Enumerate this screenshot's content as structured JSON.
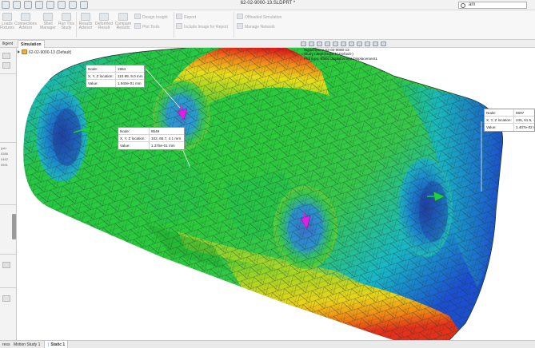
{
  "window": {
    "title": "62-02-9000-13.SLDPRT *",
    "search_value": "am"
  },
  "ribbon": {
    "buttons": [
      {
        "label_1": "Loads",
        "label_2": "Fixtures"
      },
      {
        "label_1": "Connections",
        "label_2": "Advisor"
      },
      {
        "label_1": "Shell",
        "label_2": "Manager"
      },
      {
        "label_1": "Run This",
        "label_2": "Study"
      },
      {
        "label_1": "Results",
        "label_2": "Advisor"
      },
      {
        "label_1": "Deformed",
        "label_2": "Result"
      },
      {
        "label_1": "Compare",
        "label_2": "Results"
      }
    ],
    "small_items": {
      "design_insight": "Design Insight",
      "plot_tools": "Plot Tools",
      "report": "Report",
      "include_image": "Include Image for Report",
      "offloaded_simulation": "Offloaded Simulation",
      "manage_network": "Manage Network"
    }
  },
  "tabs": {
    "intelligent": "lligent",
    "simulation": "Simulation"
  },
  "tree": {
    "study_item": "62-02-9000-13 (Default)"
  },
  "left_panel": {
    "t1": "(per",
    "t2": "0356",
    "t3": "0452",
    "t4": "0591"
  },
  "model_info": {
    "line1": "Model name:62-02-9000-13",
    "line2": "Study name:Static 1(-Default-)",
    "line3": "Plot type: Static displacement Displacement1"
  },
  "probes": {
    "p1": {
      "node_label": "Node:",
      "node": "1964",
      "xyz_label": "X, Y, Z location:",
      "xyz": "110.99, 9.0 mm",
      "value_label": "Value:",
      "value": "1.940e-01 mm"
    },
    "p2": {
      "node_label": "Node:",
      "node": "8549",
      "xyz_label": "X, Y, Z location:",
      "xyz": "102, 65.7, 4.1 mm",
      "value_label": "Value:",
      "value": "1.375e-01 mm"
    },
    "p3": {
      "node_label": "Node:",
      "node": "6597",
      "xyz_label": "X, Y, Z location:",
      "xyz": "245, 61.5, -7.",
      "value_label": "Value:",
      "value": "1.407e-02 mm"
    }
  },
  "bottom_tabs": {
    "tab1": "ress",
    "tab2": "Motion Study 1",
    "tab3": "Static 1"
  },
  "colors": {
    "stress_red": "#e51d17",
    "stress_orange": "#f28a13",
    "stress_yellow": "#e9e21a",
    "stress_green": "#2ccb3b",
    "stress_cyan": "#18b9c9",
    "stress_blue": "#1d4fd8",
    "mesh_line": "#1f3a30",
    "arrow_green": "#1fd13a",
    "arrow_magenta": "#e21ee3"
  }
}
